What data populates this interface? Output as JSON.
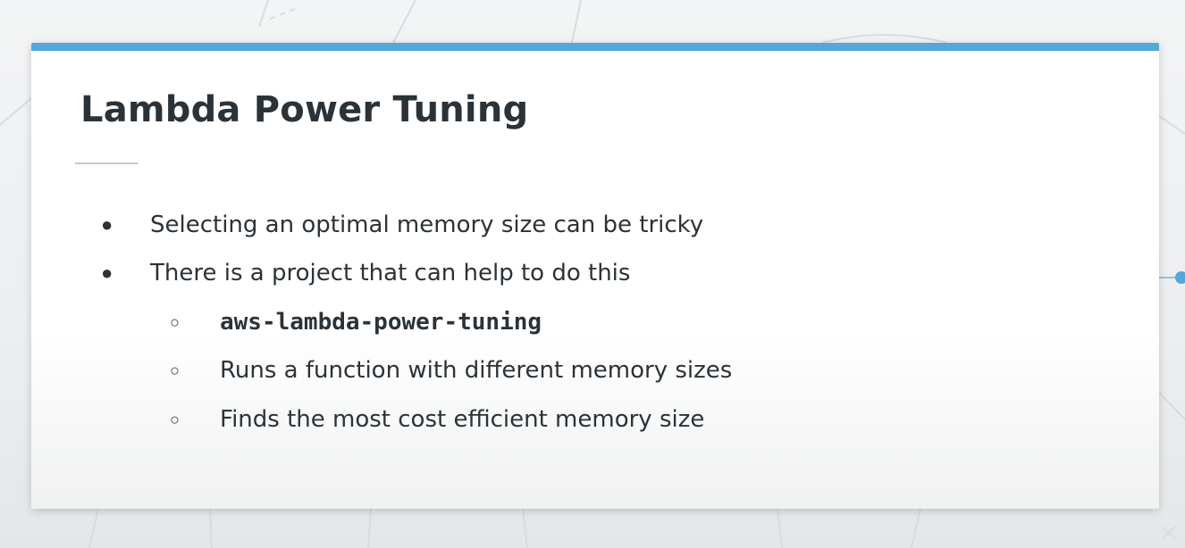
{
  "slide": {
    "title": "Lambda Power Tuning",
    "bullets": [
      {
        "level": 1,
        "marker": "●",
        "text": "Selecting an optimal memory size can be tricky",
        "mono": false
      },
      {
        "level": 1,
        "marker": "●",
        "text": "There is a project that can help to do this",
        "mono": false
      },
      {
        "level": 2,
        "marker": "○",
        "text": "aws-lambda-power-tuning",
        "mono": true
      },
      {
        "level": 2,
        "marker": "○",
        "text": "Runs a function with different memory sizes",
        "mono": false
      },
      {
        "level": 2,
        "marker": "○",
        "text": "Finds the most cost efficient memory size",
        "mono": false
      }
    ]
  },
  "colors": {
    "accent": "#55a6da",
    "text": "#2b3338",
    "background": "#eaedef"
  }
}
